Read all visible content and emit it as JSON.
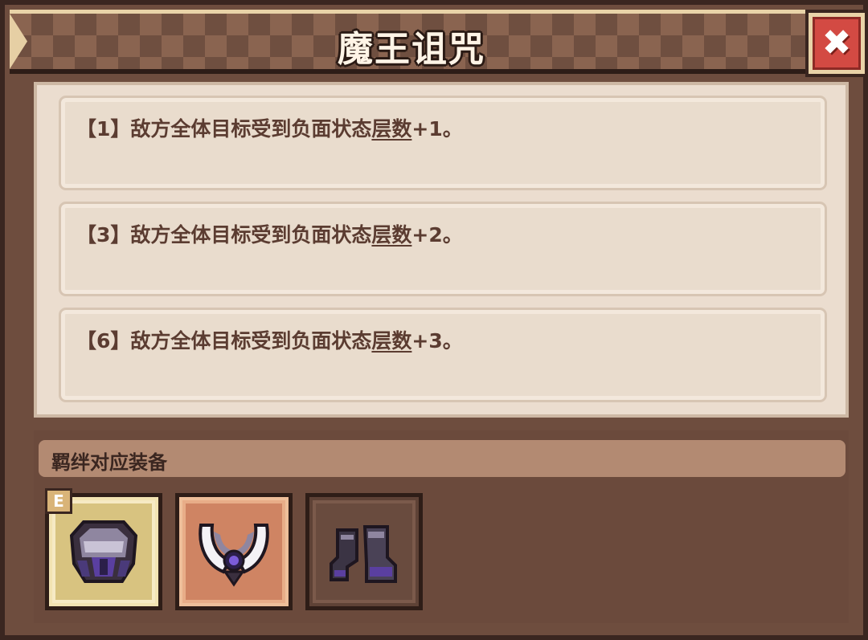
{
  "title": "魔王诅咒",
  "close_label": "✖",
  "effects": [
    {
      "prefix": "【1】敌方全体目标受到负面状态",
      "keyword": "层数",
      "suffix": "+1。"
    },
    {
      "prefix": "【3】敌方全体目标受到负面状态",
      "keyword": "层数",
      "suffix": "+2。"
    },
    {
      "prefix": "【6】敌方全体目标受到负面状态",
      "keyword": "层数",
      "suffix": "+3。"
    }
  ],
  "bond": {
    "label": "羁绊对应装备",
    "items": [
      {
        "icon": "dark-armor-icon",
        "grade": "E",
        "rarity_color": "#d8c380"
      },
      {
        "icon": "horned-amulet-icon",
        "grade": "",
        "rarity_color": "#cf8463"
      },
      {
        "icon": "dark-boots-icon",
        "grade": "",
        "rarity_color": "#694b3e"
      }
    ]
  },
  "colors": {
    "panel": "#6e4d3e",
    "text": "#5b3c31",
    "close_red": "#d34a43"
  }
}
